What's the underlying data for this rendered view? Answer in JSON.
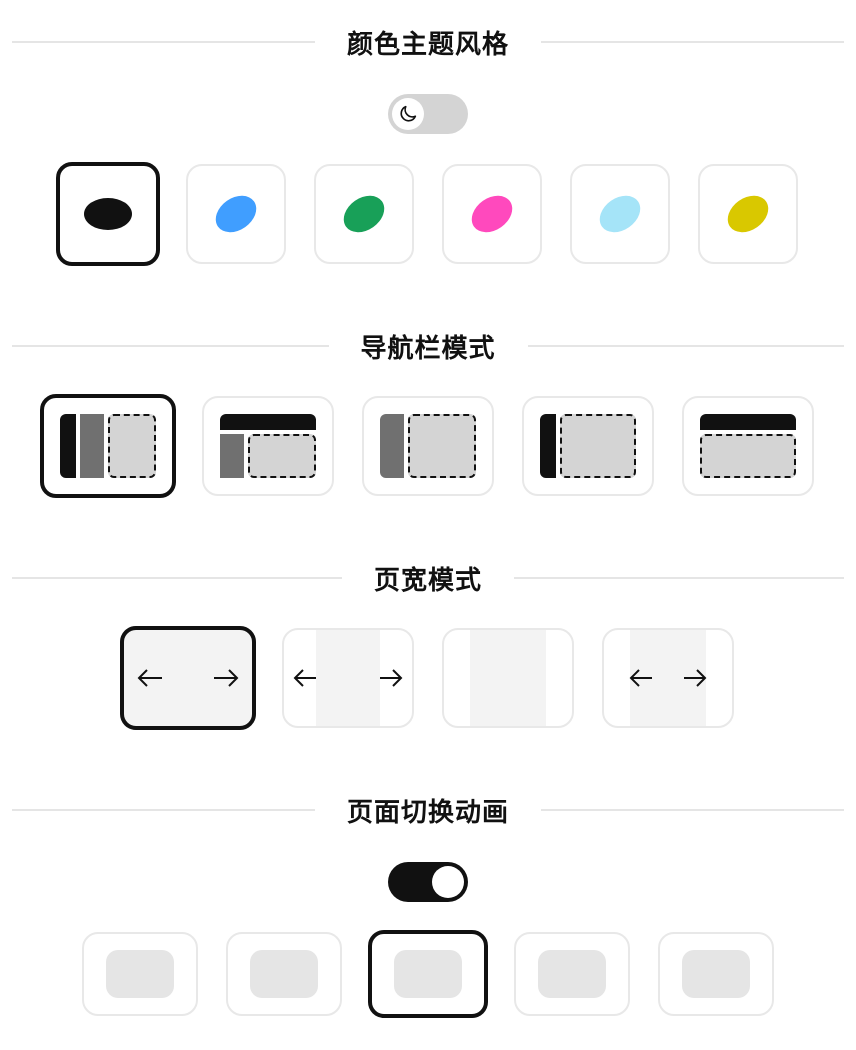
{
  "sections": {
    "color_theme": {
      "title": "颜色主题风格",
      "dark_mode_toggle": false,
      "toggle_icon": "moon-icon"
    },
    "nav_mode": {
      "title": "导航栏模式"
    },
    "page_width": {
      "title": "页宽模式"
    },
    "page_transition": {
      "title": "页面切换动画",
      "animation_toggle": true
    }
  },
  "color_options": [
    {
      "name": "black",
      "color": "#111111",
      "selected": true
    },
    {
      "name": "blue",
      "color": "#409EFF",
      "selected": false
    },
    {
      "name": "green",
      "color": "#18A058",
      "selected": false
    },
    {
      "name": "pink",
      "color": "#FF49BD",
      "selected": false
    },
    {
      "name": "light-blue",
      "color": "#A5E4F8",
      "selected": false
    },
    {
      "name": "yellow",
      "color": "#D9C800",
      "selected": false
    }
  ],
  "nav_mode_options": [
    {
      "name": "dual-sidebar",
      "selected": true
    },
    {
      "name": "top-and-side",
      "selected": false
    },
    {
      "name": "side-gray",
      "selected": false
    },
    {
      "name": "side-narrow",
      "selected": false
    },
    {
      "name": "top-only",
      "selected": false
    }
  ],
  "page_width_options": [
    {
      "name": "full-width",
      "selected": true
    },
    {
      "name": "fixed-narrow",
      "selected": false
    },
    {
      "name": "fixed-wide",
      "selected": false
    },
    {
      "name": "adaptive",
      "selected": false
    }
  ],
  "transition_options": [
    {
      "name": "option-1",
      "selected": false
    },
    {
      "name": "option-2",
      "selected": false
    },
    {
      "name": "option-3",
      "selected": true
    },
    {
      "name": "option-4",
      "selected": false
    },
    {
      "name": "option-5",
      "selected": false
    }
  ]
}
